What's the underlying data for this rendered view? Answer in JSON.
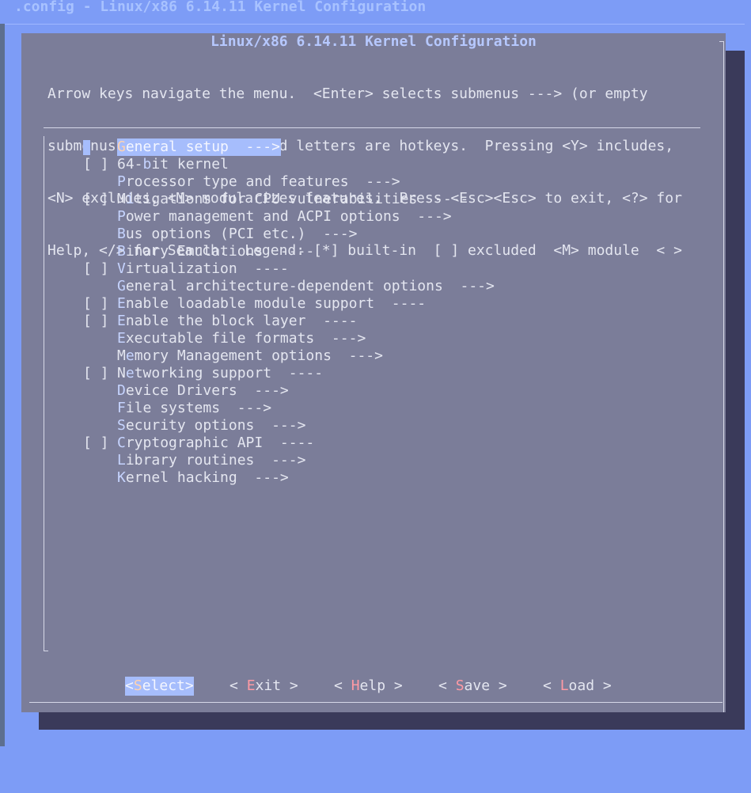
{
  "window": {
    "title": ".config - Linux/x86 6.14.11 Kernel Configuration"
  },
  "dialog": {
    "title": "Linux/x86 6.14.11 Kernel Configuration",
    "help_lines": [
      "Arrow keys navigate the menu.  <Enter> selects submenus ---> (or empty",
      "submenus ----).  Highlighted letters are hotkeys.  Pressing <Y> includes,",
      "<N> excludes, <M> modularizes features.  Press <Esc><Esc> to exit, <?> for",
      "Help, </> for Search.  Legend: [*] built-in  [ ] excluded  <M> module  < >"
    ]
  },
  "menu": {
    "items": [
      {
        "box": "",
        "hotkey": "G",
        "pre": "",
        "post": "eneral setup  --->",
        "selected": true
      },
      {
        "box": "[ ]",
        "hotkey": "b",
        "pre": "64-",
        "post": "it kernel",
        "selected": false
      },
      {
        "box": "",
        "hotkey": "P",
        "pre": "",
        "post": "rocessor type and features  --->",
        "selected": false
      },
      {
        "box": "[ ]",
        "hotkey": "i",
        "pre": "M",
        "post": "tigations for CPU vulnerabilities  ----",
        "selected": false
      },
      {
        "box": "",
        "hotkey": "P",
        "pre": "",
        "post": "ower management and ACPI options  --->",
        "selected": false
      },
      {
        "box": "",
        "hotkey": "B",
        "pre": "",
        "post": "us options (PCI etc.)  --->",
        "selected": false
      },
      {
        "box": "",
        "hotkey": "B",
        "pre": "",
        "post": "inary Emulations  ----",
        "selected": false
      },
      {
        "box": "[ ]",
        "hotkey": "V",
        "pre": "",
        "post": "irtualization  ----",
        "selected": false
      },
      {
        "box": "",
        "hotkey": "G",
        "pre": "",
        "post": "eneral architecture-dependent options  --->",
        "selected": false
      },
      {
        "box": "[ ]",
        "hotkey": "E",
        "pre": "",
        "post": "nable loadable module support  ----",
        "selected": false
      },
      {
        "box": "[ ]",
        "hotkey": "E",
        "pre": "",
        "post": "nable the block layer  ----",
        "selected": false
      },
      {
        "box": "",
        "hotkey": "E",
        "pre": "",
        "post": "xecutable file formats  --->",
        "selected": false
      },
      {
        "box": "",
        "hotkey": "e",
        "pre": "M",
        "post": "mory Management options  --->",
        "selected": false
      },
      {
        "box": "[ ]",
        "hotkey": "e",
        "pre": "N",
        "post": "tworking support  ----",
        "selected": false
      },
      {
        "box": "",
        "hotkey": "D",
        "pre": "",
        "post": "evice Drivers  --->",
        "selected": false
      },
      {
        "box": "",
        "hotkey": "F",
        "pre": "",
        "post": "ile systems  --->",
        "selected": false
      },
      {
        "box": "",
        "hotkey": "S",
        "pre": "",
        "post": "ecurity options  --->",
        "selected": false
      },
      {
        "box": "[ ]",
        "hotkey": "C",
        "pre": "",
        "post": "ryptographic API  ----",
        "selected": false
      },
      {
        "box": "",
        "hotkey": "L",
        "pre": "",
        "post": "ibrary routines  --->",
        "selected": false
      },
      {
        "box": "",
        "hotkey": "K",
        "pre": "",
        "post": "ernel hacking  --->",
        "selected": false
      }
    ]
  },
  "buttons": {
    "select": {
      "left": "<",
      "hotkey": "S",
      "rest": "elect",
      "right": ">"
    },
    "exit": {
      "left": "< ",
      "hotkey": "E",
      "rest": "xit",
      "right": " >"
    },
    "help": {
      "left": "< ",
      "hotkey": "H",
      "rest": "elp",
      "right": " >"
    },
    "save": {
      "left": "< ",
      "hotkey": "S",
      "rest": "ave",
      "right": " >"
    },
    "load": {
      "left": "< ",
      "hotkey": "L",
      "rest": "oad",
      "right": " >"
    }
  },
  "colors": {
    "background": "#7d9cf6",
    "dialog": "#7b7d99",
    "highlight": "#a6bdfc",
    "hotkey_button": "#ff9aa4"
  }
}
